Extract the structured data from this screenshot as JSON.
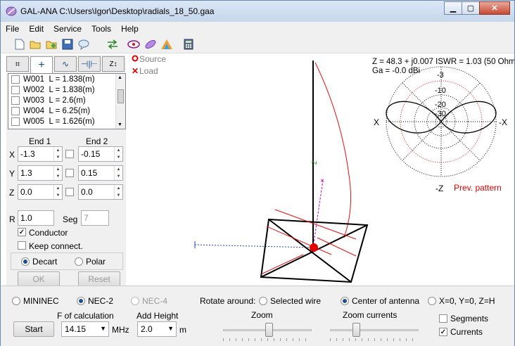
{
  "window": {
    "title": "GAL-ANA C:\\Users\\Igor\\Desktop\\radials_18_50.gaa",
    "min": "▁",
    "max": "▢",
    "close": "✕"
  },
  "menu": [
    "File",
    "Edit",
    "Service",
    "Tools",
    "Help"
  ],
  "toolbar": {
    "icons": [
      "new-file-icon",
      "open-folder-icon",
      "open-project-icon",
      "save-icon",
      "comment-icon",
      "swap-arrows-icon",
      "antenna-pattern-icon",
      "feather-icon",
      "color-map-icon",
      "calculator-icon"
    ]
  },
  "tabs": {
    "icons": [
      "wires-tab-icon",
      "crosshair-tab-icon",
      "source-tab-icon",
      "load-tab-icon",
      "network-tab-icon"
    ]
  },
  "wires": [
    {
      "name": "W001",
      "length": "L = 1.838(m)"
    },
    {
      "name": "W002",
      "length": "L = 1.838(m)"
    },
    {
      "name": "W003",
      "length": "L = 2.6(m)"
    },
    {
      "name": "W004",
      "length": "L = 6.25(m)"
    },
    {
      "name": "W005",
      "length": "L = 1.626(m)"
    }
  ],
  "wire_edit": {
    "end1_label": "End 1",
    "end2_label": "End 2",
    "x_label": "X",
    "y_label": "Y",
    "z_label": "Z",
    "x1": "-1.3",
    "y1": "1.3",
    "z1": "0.0",
    "x2": "-0.15",
    "y2": "0.15",
    "z2": "0.0",
    "r_label": "R",
    "r_value": "1.0",
    "seg_label": "Seg",
    "seg_value": "7",
    "conductor_label": "Conductor",
    "conductor_checked": true,
    "keep_label": "Keep connect.",
    "keep_checked": false,
    "decart_label": "Decart",
    "polar_label": "Polar",
    "ok_label": "OK",
    "reset_label": "Reset"
  },
  "legend": {
    "source": "Source",
    "load": "Load",
    "source_mark": "⬤",
    "load_mark": "✕"
  },
  "results": {
    "line1": "Z = 48.3 + j0.007 ISWR = 1.03 (50 Ohm)",
    "line2": "Ga = -0.0 dBi",
    "x_left": "X",
    "x_right": "-X",
    "z_bottom": "-Z",
    "rings": [
      "-3",
      "-10",
      "-20",
      "-30"
    ],
    "prev_pattern": "Prev. pattern"
  },
  "bottom": {
    "engine_mininec": "MININEC",
    "engine_nec2": "NEC-2",
    "engine_nec4": "NEC-4",
    "f_label": "F of calculation",
    "f_value": "14.15",
    "f_unit": "MHz",
    "height_label": "Add Height",
    "height_value": "2.0",
    "height_unit": "m",
    "start_label": "Start",
    "rotate_label": "Rotate around:",
    "rot_selected": "Selected wire",
    "rot_center": "Center of antenna",
    "rot_origin": "X=0, Y=0, Z=H",
    "zoom_label": "Zoom",
    "zoom_currents_label": "Zoom currents",
    "segments_label": "Segments",
    "segments_checked": false,
    "currents_label": "Currents",
    "currents_checked": true
  },
  "colors": {
    "accent": "#1d4f91",
    "source": "#e00000",
    "pattern_prev": "#e00000"
  }
}
